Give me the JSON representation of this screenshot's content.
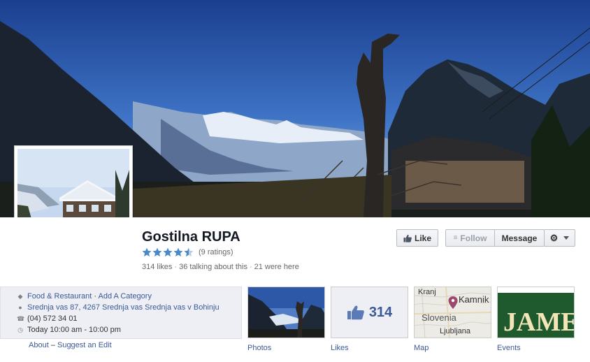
{
  "page": {
    "name": "Gostilna RUPA",
    "rating": 4.5,
    "ratings_text": "(9 ratings)",
    "stats": [
      "314 likes",
      "36 talking about this",
      "21 were here"
    ]
  },
  "actions": {
    "like": "Like",
    "follow": "Follow",
    "message": "Message",
    "settings_icon": "gear-icon"
  },
  "about": {
    "category": "Food & Restaurant",
    "add_category": "Add A Category",
    "address": "Srednja vas 87, 4267 Srednja vas Srednja vas v Bohinju",
    "phone": "(04) 572 34 01",
    "hours": "Today 10:00 am - 10:00 pm",
    "footer_about": "About",
    "footer_suggest": "Suggest an Edit"
  },
  "apps": {
    "photos": "Photos",
    "likes": "Likes",
    "likes_count": "314",
    "map": "Map",
    "events": "Events",
    "map_labels": {
      "kranj": "Kranj",
      "kamnik": "Kamnik",
      "slovenia": "Slovenia",
      "ljubljana": "Ljubljana"
    },
    "events_text": "JAME"
  },
  "colors": {
    "link": "#3b5998",
    "sky": "#1f4a9c",
    "star": "#4a89c8"
  }
}
